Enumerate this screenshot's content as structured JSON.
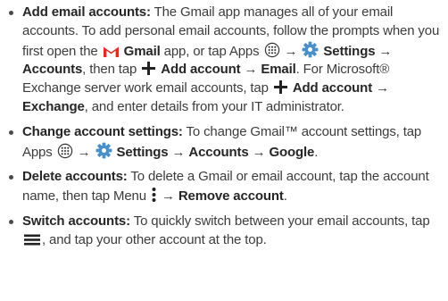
{
  "colors": {
    "text": "#3c3c3c",
    "bold_text": "#262626",
    "gmail_red": "#d93025",
    "settings_blue": "#4a90c8",
    "icon_dark": "#333333"
  },
  "items": [
    {
      "segments": [
        {
          "t": "b",
          "v": "Add email accounts:"
        },
        {
          "t": "s",
          "v": " The Gmail app manages all of your email accounts. To add personal email accounts, follow the prompts when you first open the "
        },
        {
          "t": "i",
          "icon": "gmail-icon"
        },
        {
          "t": "s",
          "v": " "
        },
        {
          "t": "b",
          "v": "Gmail"
        },
        {
          "t": "s",
          "v": " app, or tap Apps "
        },
        {
          "t": "i",
          "icon": "apps-icon"
        },
        {
          "t": "s",
          "v": " → "
        },
        {
          "t": "i",
          "icon": "settings-icon"
        },
        {
          "t": "s",
          "v": " "
        },
        {
          "t": "b",
          "v": "Settings"
        },
        {
          "t": "s",
          "v": " → "
        },
        {
          "t": "b",
          "v": "Accounts"
        },
        {
          "t": "s",
          "v": ", then tap "
        },
        {
          "t": "i",
          "icon": "plus-icon"
        },
        {
          "t": "s",
          "v": " "
        },
        {
          "t": "b",
          "v": "Add account"
        },
        {
          "t": "s",
          "v": " → "
        },
        {
          "t": "b",
          "v": "Email"
        },
        {
          "t": "s",
          "v": ". For Microsoft® Exchange server work email accounts, tap "
        },
        {
          "t": "i",
          "icon": "plus-icon"
        },
        {
          "t": "s",
          "v": " "
        },
        {
          "t": "b",
          "v": "Add account"
        },
        {
          "t": "s",
          "v": " → "
        },
        {
          "t": "b",
          "v": "Exchange"
        },
        {
          "t": "s",
          "v": ", and enter details from your IT administrator."
        }
      ]
    },
    {
      "segments": [
        {
          "t": "b",
          "v": "Change account settings:"
        },
        {
          "t": "s",
          "v": " To change Gmail™ account settings, tap Apps "
        },
        {
          "t": "i",
          "icon": "apps-icon"
        },
        {
          "t": "s",
          "v": " → "
        },
        {
          "t": "i",
          "icon": "settings-icon"
        },
        {
          "t": "s",
          "v": " "
        },
        {
          "t": "b",
          "v": "Settings"
        },
        {
          "t": "s",
          "v": " → "
        },
        {
          "t": "b",
          "v": "Accounts"
        },
        {
          "t": "s",
          "v": " → "
        },
        {
          "t": "b",
          "v": "Google"
        },
        {
          "t": "s",
          "v": "."
        }
      ]
    },
    {
      "segments": [
        {
          "t": "b",
          "v": "Delete accounts:"
        },
        {
          "t": "s",
          "v": " To delete a Gmail or email account, tap the account name, then tap Menu "
        },
        {
          "t": "i",
          "icon": "menu-dots-icon"
        },
        {
          "t": "s",
          "v": " → "
        },
        {
          "t": "b",
          "v": "Remove account"
        },
        {
          "t": "s",
          "v": "."
        }
      ]
    },
    {
      "segments": [
        {
          "t": "b",
          "v": "Switch accounts:"
        },
        {
          "t": "s",
          "v": " To quickly switch between your email accounts, tap "
        },
        {
          "t": "i",
          "icon": "hamburger-icon"
        },
        {
          "t": "s",
          "v": ", and tap your other account at the top."
        }
      ]
    }
  ]
}
